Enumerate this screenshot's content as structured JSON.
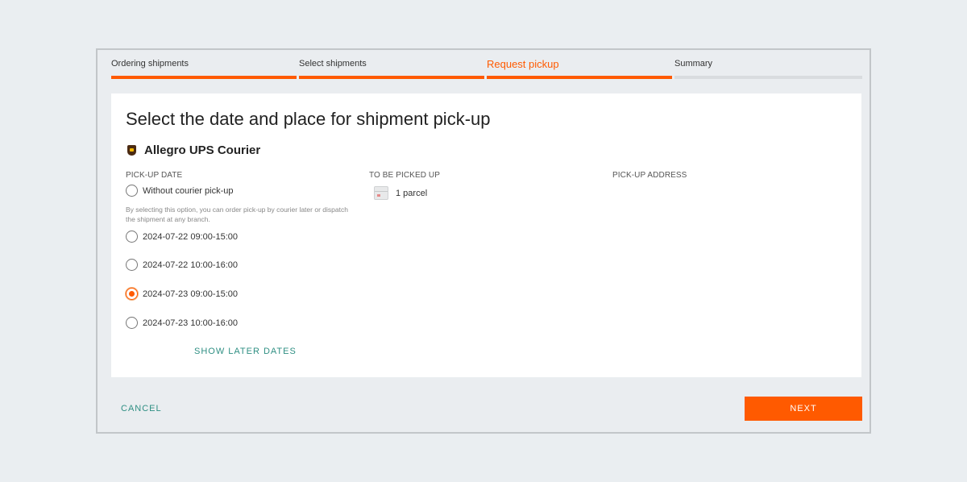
{
  "stepper": {
    "steps": [
      {
        "label": "Ordering shipments",
        "state": "done"
      },
      {
        "label": "Select shipments",
        "state": "done"
      },
      {
        "label": "Request pickup",
        "state": "active"
      },
      {
        "label": "Summary",
        "state": "pending"
      }
    ]
  },
  "card": {
    "title": "Select the date and place for shipment pick-up",
    "carrier": {
      "name": "Allegro UPS Courier",
      "icon": "ups-logo-icon"
    },
    "columns": {
      "pickup_date": "PICK-UP DATE",
      "to_be_picked_up": "TO BE PICKED UP",
      "pickup_address": "PICK-UP ADDRESS"
    },
    "options": [
      {
        "label": "Without courier pick-up",
        "checked": false
      },
      {
        "label": "2024-07-22 09:00-15:00",
        "checked": false
      },
      {
        "label": "2024-07-22 10:00-16:00",
        "checked": false
      },
      {
        "label": "2024-07-23 09:00-15:00",
        "checked": true
      },
      {
        "label": "2024-07-23 10:00-16:00",
        "checked": false
      }
    ],
    "hint": "By selecting this option, you can order pick-up by courier later or dispatch the shipment at any branch.",
    "show_later_dates": "SHOW LATER DATES",
    "parcel": {
      "label": "1 parcel",
      "icon": "parcel-icon"
    }
  },
  "footer": {
    "cancel_label": "CANCEL",
    "next_label": "NEXT"
  },
  "colors": {
    "accent": "#ff5a00",
    "link": "#2f8f83",
    "background": "#eaeef1"
  }
}
